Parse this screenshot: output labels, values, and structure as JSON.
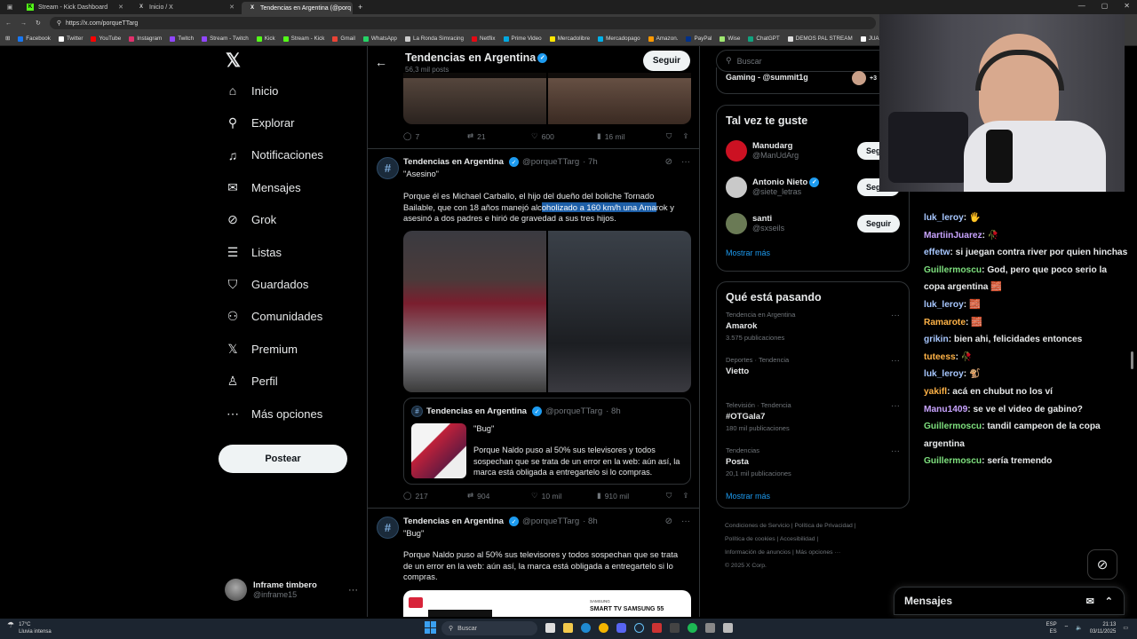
{
  "browser": {
    "tabs": [
      {
        "title": "Stream - Kick Dashboard",
        "favicon": "K",
        "color": "#53fc18"
      },
      {
        "title": "Inicio / X",
        "favicon": "X",
        "color": "#ffffff"
      },
      {
        "title": "Tendencias en Argentina (@porq",
        "favicon": "X",
        "color": "#ffffff"
      }
    ],
    "url": "https://x.com/porqueTTarg",
    "bookmarks": [
      {
        "label": "Facebook",
        "color": "#1877f2"
      },
      {
        "label": "Twitter",
        "color": "#ffffff"
      },
      {
        "label": "YouTube",
        "color": "#ff0000"
      },
      {
        "label": "Instagram",
        "color": "#e1306c"
      },
      {
        "label": "Twitch",
        "color": "#9146ff"
      },
      {
        "label": "Stream - Twitch",
        "color": "#9146ff"
      },
      {
        "label": "Kick",
        "color": "#53fc18"
      },
      {
        "label": "Stream - Kick",
        "color": "#53fc18"
      },
      {
        "label": "Gmail",
        "color": "#ea4335"
      },
      {
        "label": "WhatsApp",
        "color": "#25d366"
      },
      {
        "label": "La Ronda Simracing",
        "color": "#cccccc"
      },
      {
        "label": "Netflix",
        "color": "#e50914"
      },
      {
        "label": "Prime Video",
        "color": "#00a8e1"
      },
      {
        "label": "Mercadolibre",
        "color": "#ffe600"
      },
      {
        "label": "Mercadopago",
        "color": "#00b1ea"
      },
      {
        "label": "Amazon.",
        "color": "#ff9900"
      },
      {
        "label": "PayPal",
        "color": "#003087"
      },
      {
        "label": "Wise",
        "color": "#9fe870"
      },
      {
        "label": "ChatGPT",
        "color": "#10a37f"
      },
      {
        "label": "DEMOS PAL STREAM",
        "color": "#dddddd"
      },
      {
        "label": "JUAN TUR",
        "color": "#ffffff"
      }
    ]
  },
  "nav": {
    "logo": "𝕏",
    "items": [
      {
        "label": "Inicio",
        "icon": "⌂"
      },
      {
        "label": "Explorar",
        "icon": "⚲"
      },
      {
        "label": "Notificaciones",
        "icon": "♫"
      },
      {
        "label": "Mensajes",
        "icon": "✉"
      },
      {
        "label": "Grok",
        "icon": "⊘"
      },
      {
        "label": "Listas",
        "icon": "☰"
      },
      {
        "label": "Guardados",
        "icon": "⛉"
      },
      {
        "label": "Comunidades",
        "icon": "⚇"
      },
      {
        "label": "Premium",
        "icon": "𝕏"
      },
      {
        "label": "Perfil",
        "icon": "♙"
      },
      {
        "label": "Más opciones",
        "icon": "⋯"
      }
    ],
    "post_label": "Postear",
    "user": {
      "name": "Inframe timbero",
      "handle": "@inframe15"
    }
  },
  "feed": {
    "title": "Tendencias en Argentina",
    "post_count": "56,3 mil posts",
    "follow_label": "Seguir",
    "top_actions": {
      "replies": "7",
      "reposts": "21",
      "likes": "600",
      "views": "16 mil"
    },
    "tweet1": {
      "name": "Tendencias en Argentina",
      "handle": "@porqueTTarg",
      "time": "· 7h",
      "title": "\"Asesino\"",
      "body_before": "Porque él es Michael Carballo, el hijo del dueño del boliche Tornado Bailable, que con 18 años manejó alc",
      "body_highlight": "oholizado a 160 km/h una Ama",
      "body_after": "rok y asesinó a dos padres e hirió de gravedad a sus tres hijos.",
      "quote": {
        "name": "Tendencias en Argentina",
        "handle": "@porqueTTarg",
        "time": "· 8h",
        "title": "\"Bug\"",
        "body": "Porque Naldo puso al 50% sus televisores y todos sospechan que se trata de un error en la web: aún así, la marca está obligada a entregartelo si lo compras."
      },
      "actions": {
        "replies": "217",
        "reposts": "904",
        "likes": "10 mil",
        "views": "910 mil"
      }
    },
    "tweet2": {
      "name": "Tendencias en Argentina",
      "handle": "@porqueTTarg",
      "time": "· 8h",
      "title": "\"Bug\"",
      "body": "Porque Naldo puso al 50% sus televisores y todos sospechan que se trata de un error en la web: aún así, la marca está obligada a entregartelo si lo compras.",
      "card_brand": "SAMSUNG",
      "card_text": "SMART TV SAMSUNG 55"
    }
  },
  "sidebar": {
    "search_placeholder": "Buscar",
    "top_item": "Gaming - @summit1g",
    "top_badge": "+3",
    "suggestions_title": "Tal vez te guste",
    "suggestions": [
      {
        "name": "Manudarg",
        "handle": "@ManUdArg",
        "verified": false,
        "color": "#cc1122"
      },
      {
        "name": "Antonio Nieto",
        "handle": "@siete_letras",
        "verified": true,
        "color": "#c9c9c9"
      },
      {
        "name": "santi",
        "handle": "@sxseils",
        "verified": false,
        "color": "#6a7a55"
      }
    ],
    "follow_label": "Seguir",
    "show_more": "Mostrar más",
    "trends_title": "Qué está pasando",
    "trends": [
      {
        "context": "Tendencia en Argentina",
        "name": "Amarok",
        "count": "3.575 publicaciones"
      },
      {
        "context": "Deportes · Tendencia",
        "name": "Vietto",
        "count": ""
      },
      {
        "context": "Televisión · Tendencia",
        "name": "#OTGala7",
        "count": "180 mil publicaciones"
      },
      {
        "context": "Tendencias",
        "name": "Posta",
        "count": "20,1 mil publicaciones"
      }
    ],
    "footer": [
      "Condiciones de Servicio",
      "Política de Privacidad",
      "Política de cookies",
      "Accesibilidad",
      "Información de anuncios",
      "Más opciones ···",
      "© 2025 X Corp."
    ]
  },
  "chat": {
    "lines": [
      {
        "user": "luk_leroy",
        "color": "#a7c7ff",
        "text": ": 🖐"
      },
      {
        "user": "MartiinJuarez",
        "color": "#c9a4ff",
        "text": ": 🥀"
      },
      {
        "user": "effetw",
        "color": "#a7c7ff",
        "text": ": si juegan contra river por quien hinchas"
      },
      {
        "user": "Guillermoscu",
        "color": "#7ee07e",
        "text": ": God, pero que poco serio la copa argentina 🧱"
      },
      {
        "user": "luk_leroy",
        "color": "#a7c7ff",
        "text": ": 🧱"
      },
      {
        "user": "Ramarote",
        "color": "#ffb347",
        "text": ": 🧱"
      },
      {
        "user": "grikin",
        "color": "#a7c7ff",
        "text": ": bien ahi, felicidades entonces"
      },
      {
        "user": "tuteess",
        "color": "#ffb347",
        "text": ": 🥀"
      },
      {
        "user": "luk_leroy",
        "color": "#a7c7ff",
        "text": ": 🐒"
      },
      {
        "user": "yakifl",
        "color": "#ffb347",
        "text": ": acá en chubut no los ví"
      },
      {
        "user": "Manu1409",
        "color": "#c9a4ff",
        "text": ": se ve el video de gabino?"
      },
      {
        "user": "Guillermoscu",
        "color": "#7ee07e",
        "text": ": tandil campeon de la copa argentina"
      },
      {
        "user": "Guillermoscu",
        "color": "#7ee07e",
        "text": ": sería tremendo"
      }
    ]
  },
  "messages_bar": {
    "label": "Mensajes"
  },
  "taskbar": {
    "weather_temp": "17°C",
    "weather_desc": "Lluvia intensa",
    "search_placeholder": "Buscar",
    "lang": "ESP",
    "lang2": "ES",
    "time": "21:13",
    "date": "03/11/2025"
  }
}
